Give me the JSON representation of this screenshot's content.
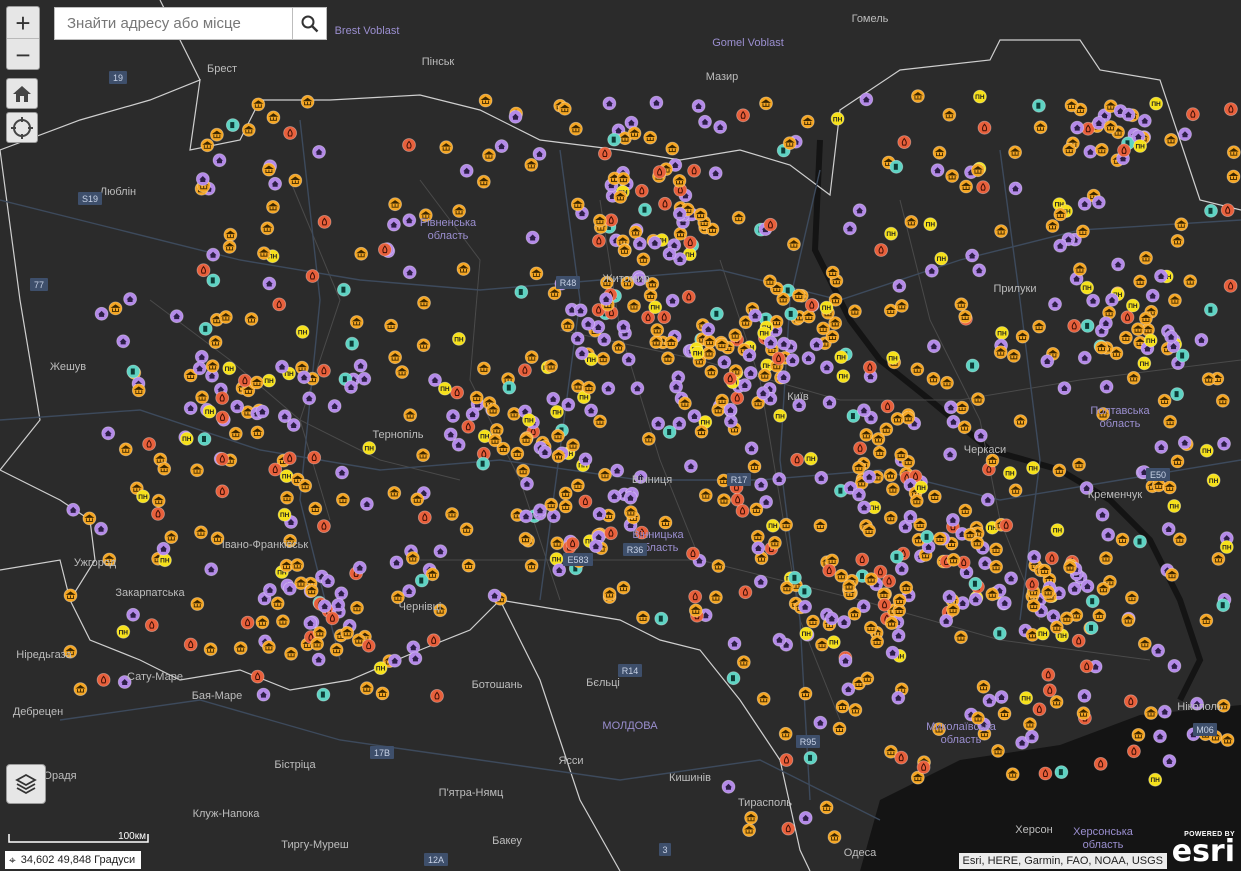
{
  "search": {
    "placeholder": "Знайти адресу або місце"
  },
  "controls": {
    "zoom_in": "+",
    "zoom_out": "−"
  },
  "scale": {
    "label": "100км"
  },
  "coords": {
    "text": "34,602 49,848 Градуси"
  },
  "attribution": "Esri, HERE, Garmin, FAO, NOAA, USGS",
  "esri": {
    "powered": "POWERED BY",
    "logo": "esri"
  },
  "colors": {
    "bank": "#f5a623",
    "home": "#b48ae8",
    "fire": "#e8603c",
    "fuel": "#5fd3c3",
    "pn": "#f6e11b"
  },
  "places": [
    "Гомель",
    "Brest Voblast",
    "Gomel Voblast",
    "Брест",
    "Пінськ",
    "Мазир",
    "Люблін",
    "Рівненська область",
    "Житомир",
    "Жешув",
    "Тернопіль",
    "Київ",
    "Вінниця",
    "Вінницька область",
    "Ужгород",
    "Закарпатська",
    "Івано-Франківськ",
    "Чернівці",
    "Ніредьгаза",
    "Сату-Маре",
    "Бая-Маре",
    "Дебрецен",
    "Орадя",
    "Ботошань",
    "Бєльці",
    "МОЛДОВА",
    "Бістріца",
    "Клуж-Напока",
    "П'ятра-Нямц",
    "Ясси",
    "Кишинів",
    "Бакеу",
    "Тирасполь",
    "Тиргу-Муреш",
    "Прилуки",
    "Полтавська область",
    "Черкаси",
    "Кременчук",
    "Миколаївська область",
    "Одеса",
    "Херсон",
    "Херсонська область",
    "Нікополь"
  ],
  "roads": [
    "19",
    "S19",
    "77",
    "R48",
    "R17",
    "E583",
    "R14",
    "17B",
    "12A",
    "3",
    "R36",
    "E50",
    "R95",
    "M06"
  ]
}
